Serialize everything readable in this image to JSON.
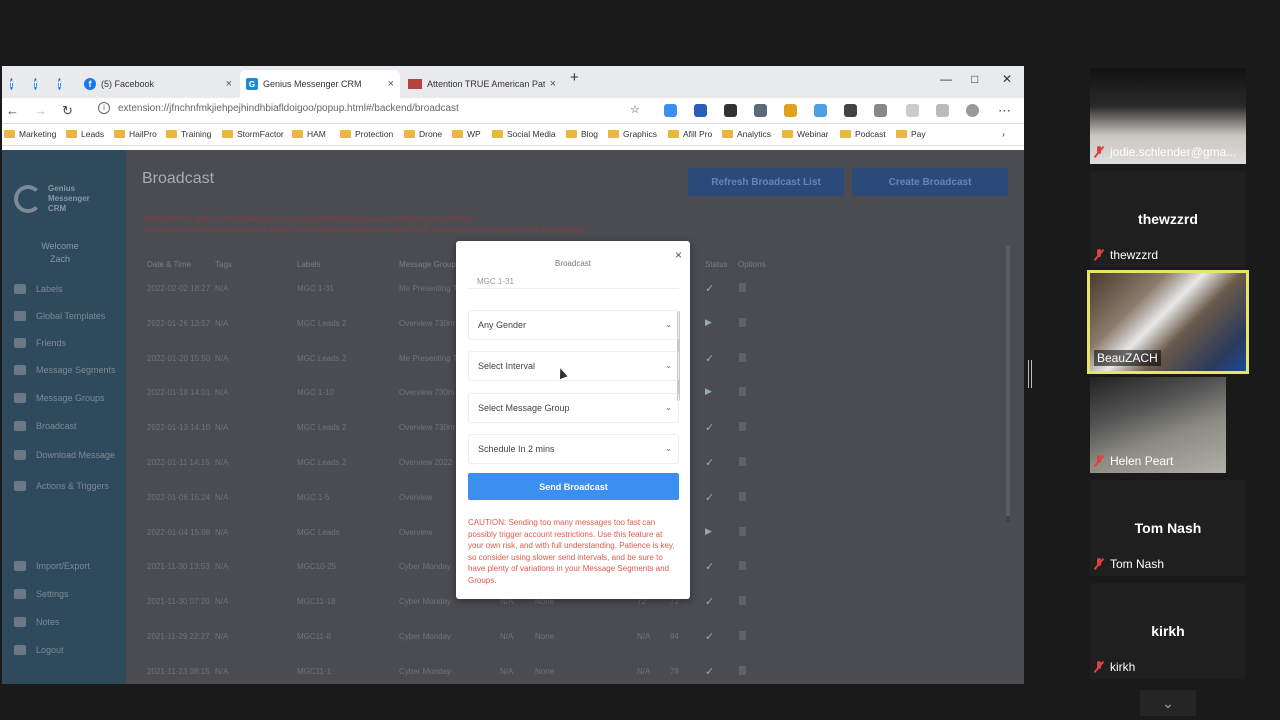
{
  "browser": {
    "tabs": [
      {
        "label": "(5) Facebook"
      },
      {
        "label": "Genius Messenger CRM"
      },
      {
        "label": "Attention TRUE American Patriot"
      }
    ],
    "new_tab": "+",
    "close": "×",
    "url": "extension://jfnchnfmkjiehpejhindhbiafldoigoo/popup.html#/backend/broadcast",
    "bookmarks": [
      "Marketing",
      "Leads",
      "HailPro",
      "Training",
      "StormFactor",
      "HAM",
      "Protection",
      "Drone",
      "WP",
      "Social Media",
      "Blog",
      "Graphics",
      "Afill Pro",
      "Analytics",
      "Webinar",
      "Podcast",
      "Pay"
    ]
  },
  "app": {
    "logo_lines": [
      "Genius",
      "Messenger",
      "CRM"
    ],
    "welcome": "Welcome",
    "user": "Zach",
    "sidebar": [
      {
        "label": "Labels",
        "icon": "tag-icon"
      },
      {
        "label": "Global Templates",
        "icon": "template-icon"
      },
      {
        "label": "Friends",
        "icon": "users-icon"
      },
      {
        "label": "Message Segments",
        "icon": "segments-icon"
      },
      {
        "label": "Message Groups",
        "icon": "groups-icon"
      },
      {
        "label": "Broadcast",
        "icon": "megaphone-icon"
      },
      {
        "label": "Download Message",
        "icon": "download-icon"
      },
      {
        "label": "Actions & Triggers",
        "icon": "bolt-icon"
      },
      {
        "label": "Import/Export",
        "icon": "import-icon"
      },
      {
        "label": "Settings",
        "icon": "gear-icon"
      },
      {
        "label": "Notes",
        "icon": "note-icon"
      },
      {
        "label": "Logout",
        "icon": "power-icon"
      }
    ],
    "page_title": "Broadcast",
    "refresh_button": "Refresh Broadcast List",
    "create_button": "Create Broadcast",
    "notes": [
      "*Note: When it starts a new broadcast, any running broadcasts will pause and the new one will start.",
      "*Only last recent 10 broadcast will be shown here. Broadcast which have status 'done' and are older than 5 days will be auto deleted."
    ],
    "columns": [
      "Date & Time",
      "Tags",
      "Labels",
      "Message Group",
      "Status",
      "Options"
    ],
    "rows": [
      {
        "date": "2022-02-02 18:27",
        "tags": "N/A",
        "label": "MGC 1-31",
        "group": "Me Presenting T",
        "status": "check"
      },
      {
        "date": "2022-01-26 13:57",
        "tags": "N/A",
        "label": "MGC Leads 2",
        "group": "Overview 730m",
        "status": "play"
      },
      {
        "date": "2022-01-20 15:50",
        "tags": "N/A",
        "label": "MGC Leads 2",
        "group": "Me Presenting T",
        "status": "check"
      },
      {
        "date": "2022-01-18 14:01",
        "tags": "N/A",
        "label": "MGC 1-10",
        "group": "Overview 730m",
        "status": "play"
      },
      {
        "date": "2022-01-13 14:10",
        "tags": "N/A",
        "label": "MGC Leads 2",
        "group": "Overview 730m",
        "status": "check"
      },
      {
        "date": "2022-01-11 14:15",
        "tags": "N/A",
        "label": "MGC Leads 2",
        "group": "Overview 2022",
        "status": "check"
      },
      {
        "date": "2022-01-06 15:24",
        "tags": "N/A",
        "label": "MGC 1-5",
        "group": "Overview",
        "status": "check"
      },
      {
        "date": "2022-01-04 15:08",
        "tags": "N/A",
        "label": "MGC Leads",
        "group": "Overview",
        "status": "play"
      },
      {
        "date": "2021-11-30 13:53",
        "tags": "N/A",
        "label": "MGC10-25",
        "group": "Cyber Monday",
        "status": "check"
      },
      {
        "date": "2021-11-30 07:20",
        "tags": "N/A",
        "label": "MGC11-18",
        "group": "Cyber Monday",
        "extra1": "N/A",
        "extra2": "None",
        "n1": "72",
        "n2": "72",
        "status": "check"
      },
      {
        "date": "2021-11-29 22:27",
        "tags": "N/A",
        "label": "MGC11-8",
        "group": "Cyber Monday",
        "extra1": "N/A",
        "extra2": "None",
        "n1": "N/A",
        "n2": "94",
        "status": "check"
      },
      {
        "date": "2021-11-23 08:15",
        "tags": "N/A",
        "label": "MGC11-1",
        "group": "Cyber Monday",
        "extra1": "N/A",
        "extra2": "None",
        "n1": "N/A",
        "n2": "78",
        "status": "check"
      }
    ]
  },
  "modal": {
    "title": "Broadcast",
    "close": "×",
    "partial_select": "MGC 1-31",
    "gender": "Any Gender",
    "interval": "Select Interval",
    "group": "Select Message Group",
    "schedule": "Schedule In 2 mins",
    "send_button": "Send Broadcast",
    "caution": "CAUTION: Sending too many messages too fast can possibly trigger account restrictions. Use this feature at your own risk, and with full understanding. Patience is key, so consider using slower send intervals, and be sure to have plenty of variations in your Message Segments and Groups."
  },
  "participants": [
    {
      "name": "jodie.schlender@gma...",
      "big": "",
      "muted": true
    },
    {
      "name": "thewzzrd",
      "big": "thewzzrd",
      "muted": true
    },
    {
      "name": "BeauZACH",
      "big": "",
      "muted": false
    },
    {
      "name": "Helen Peart",
      "big": "",
      "muted": true
    },
    {
      "name": "Tom Nash",
      "big": "Tom Nash",
      "muted": true
    },
    {
      "name": "kirkh",
      "big": "kirkh",
      "muted": true
    }
  ],
  "colors": {
    "accent": "#3b8ff0",
    "caution": "#e05a4a",
    "active_speaker": "#e5e56a"
  }
}
